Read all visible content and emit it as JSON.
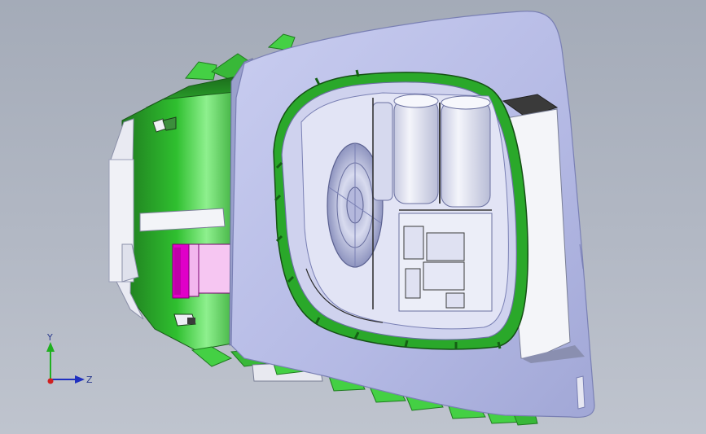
{
  "viewport": {
    "background_top": "#a4abb8",
    "background_bottom": "#bfc4ce"
  },
  "model": {
    "housing_color": "#2fbf2f",
    "housing_highlight": "#8ef08e",
    "housing_shadow": "#1f7a1f",
    "faceplate_color": "#b7bde6",
    "faceplate_edge": "#8c93c4",
    "cell_color": "#e4e6f4",
    "connector_color": "#e000c8",
    "connector_light": "#f3b6ee",
    "window_dark": "#3a3a3a"
  },
  "triad": {
    "x_label": "",
    "y_label": "Y",
    "z_label": "Z",
    "x_color": "#d02020",
    "y_color": "#1fb01f",
    "z_color": "#2030c0"
  }
}
